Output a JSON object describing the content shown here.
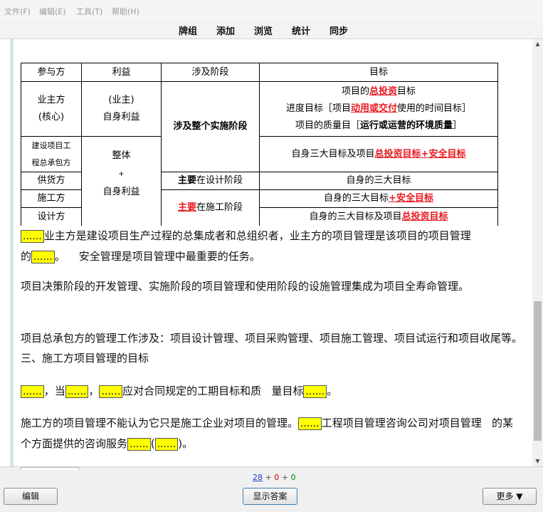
{
  "menu": [
    "文件(F)",
    "编辑(E)",
    "工具(T)",
    "帮助(H)"
  ],
  "toolbar": [
    "牌组",
    "添加",
    "浏览",
    "统计",
    "同步"
  ],
  "table": {
    "headers": [
      "参与方",
      "利益",
      "涉及阶段",
      "目标"
    ],
    "owner_party_a": "业主方",
    "owner_party_b": "(核心)",
    "owner_interest_a": "(业主)",
    "owner_interest_b": "自身利益",
    "stage_all": "涉及整个实施阶段",
    "owner_goal_1a": "项目的",
    "owner_goal_1b": "总投资",
    "owner_goal_1c": "目标",
    "owner_goal_2a": "进度目标［项目",
    "owner_goal_2b": "动用或交付",
    "owner_goal_2c": "使用的时间目标］",
    "owner_goal_3a": "项目的质量目［",
    "owner_goal_3b": "运行或运营的环境质量",
    "owner_goal_3c": "］",
    "contractor_a": "建设项目工",
    "contractor_b": "程总承包方",
    "whole_interest_a": "整体",
    "whole_interest_b": "+",
    "whole_interest_c": "自身利益",
    "contractor_goal_a": "自身三大目标及项目",
    "contractor_goal_b": "总投资目标+安全目标",
    "supplier": "供货方",
    "supplier_stage_a": "主要",
    "supplier_stage_b": "在设计阶段",
    "supplier_goal": "自身的三大目标",
    "builder": "施工方",
    "builder_stage_a": "主要",
    "builder_stage_b": "在施工阶段",
    "builder_goal_a": "自身的三大目标",
    "builder_goal_b": "+安全目标",
    "designer": "设计方",
    "designer_goal_a": "自身的三大目标及项目",
    "designer_goal_b": "总投资目标"
  },
  "blank": "......",
  "paragraphs": {
    "p1a": "业主方是建设项目生产过程的总集成者和总组织者，业主方的项目管理是该项目的项目管理的",
    "p1b": "。    安全管理是项目管理中最重要的任务。",
    "p2": "项目决策阶段的开发管理、实施阶段的项目管理和使用阶段的设施管理集成为项目全寿命管理。",
    "p3": "项目总承包方的管理工作涉及：项目设计管理、项目采购管理、项目施工管理、项目试运行和项目收尾等。    三、施工方项目管理的目标",
    "p4a": "，当",
    "p4b": "，",
    "p4c": "应对合同规定的工期目标和质   量目标",
    "p4d": "。",
    "p5a": "施工方的项目管理不能认为它只是施工企业对项目的管理。",
    "p5b": "工程项目管理咨询公司对项目管理   的某个方面提供的咨询服务",
    "p5c": "(",
    "p5d": ")。"
  },
  "status": {
    "new": "28",
    "sep1": " + ",
    "learn": "0",
    "sep2": " + ",
    "review": "0"
  },
  "buttons": {
    "edit": "编辑",
    "show_answer": "显示答案",
    "more": "更多 ▼"
  },
  "colors": {
    "new": "#1a3fd6",
    "learn": "#cc0000",
    "review": "#008800",
    "highlight": "#ffff00"
  }
}
